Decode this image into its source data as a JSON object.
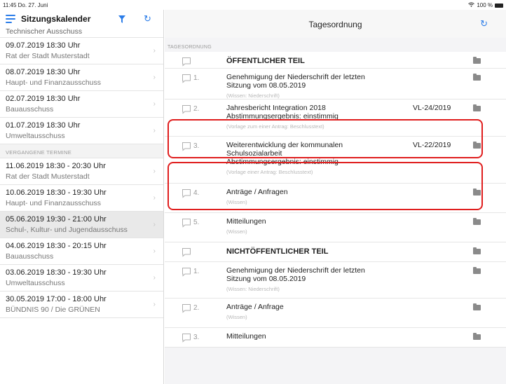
{
  "status_bar": {
    "time_date": "11:45  Do. 27. Juni",
    "battery": "100 %"
  },
  "sidebar": {
    "title": "Sitzungskalender",
    "cut_item": {
      "line2": "Technischer Ausschuss"
    },
    "upcoming": [
      {
        "datetime": "09.07.2019 18:30 Uhr",
        "body": "Rat der Stadt Musterstadt"
      },
      {
        "datetime": "08.07.2019 18:30 Uhr",
        "body": "Haupt- und Finanzausschuss"
      },
      {
        "datetime": "02.07.2019 18:30 Uhr",
        "body": "Bauausschuss"
      },
      {
        "datetime": "01.07.2019 18:30 Uhr",
        "body": "Umweltausschuss"
      }
    ],
    "past_header": "VERGANGENE TERMINE",
    "past": [
      {
        "datetime": "11.06.2019 18:30 -  20:30 Uhr",
        "body": "Rat der Stadt Musterstadt"
      },
      {
        "datetime": "10.06.2019 18:30 -  19:30 Uhr",
        "body": "Haupt- und Finanzausschuss"
      },
      {
        "datetime": "05.06.2019 19:30 -  21:00 Uhr",
        "body": "Schul-, Kultur- und Jugendausschuss"
      },
      {
        "datetime": "04.06.2019 18:30 -  20:15 Uhr",
        "body": "Bauausschuss"
      },
      {
        "datetime": "03.06.2019 18:30 -  19:30 Uhr",
        "body": "Umweltausschuss"
      },
      {
        "datetime": "30.05.2019 17:00 -  18:00 Uhr",
        "body": "BÜNDNIS 90 / Die GRÜNEN"
      }
    ]
  },
  "main": {
    "title": "Tagesordnung",
    "section_label": "TAGESORDNUNG",
    "items": [
      {
        "num": "",
        "title": "ÖFFENTLICHER TEIL",
        "sub": "",
        "ref": ""
      },
      {
        "num": "1.",
        "title": "Genehmigung der Niederschrift der letzten\nSitzung vom 08.05.2019",
        "sub": "(Wissen: Niederschrift)",
        "ref": ""
      },
      {
        "num": "2.",
        "title": "Jahresbericht Integration 2018\nAbstimmungsergebnis: einstimmig",
        "sub": "(Vorlage zum einer Antrag: Beschlusstext)",
        "ref": "VL-24/2019"
      },
      {
        "num": "3.",
        "title": "Weiterentwicklung der kommunalen\nSchulsozialarbeit\nAbstimmungsergebnis: einstimmig",
        "sub": "(Vorlage einer Antrag: Beschlusstext)",
        "ref": "VL-22/2019"
      },
      {
        "num": "4.",
        "title": "Anträge / Anfragen",
        "sub": "(Wissen)",
        "ref": ""
      },
      {
        "num": "5.",
        "title": "Mitteilungen",
        "sub": "(Wissen)",
        "ref": ""
      },
      {
        "num": "",
        "title": "NICHTÖFFENTLICHER TEIL",
        "sub": "",
        "ref": ""
      },
      {
        "num": "1.",
        "title": "Genehmigung der Niederschrift der letzten\nSitzung vom 08.05.2019",
        "sub": "(Wissen: Niederschrift)",
        "ref": ""
      },
      {
        "num": "2.",
        "title": "Anträge / Anfrage",
        "sub": "(Wissen)",
        "ref": ""
      },
      {
        "num": "3.",
        "title": "Mitteilungen",
        "sub": "",
        "ref": ""
      }
    ]
  },
  "colors": {
    "accent": "#2b7de9",
    "highlight": "#e01e1e"
  }
}
